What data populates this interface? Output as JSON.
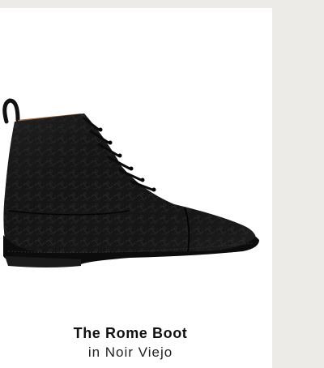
{
  "product": {
    "name": "The Rome Boot",
    "colorway": "in Noir Viejo",
    "image_alt": "Black embossed leather cap-toe lace-up boot"
  }
}
